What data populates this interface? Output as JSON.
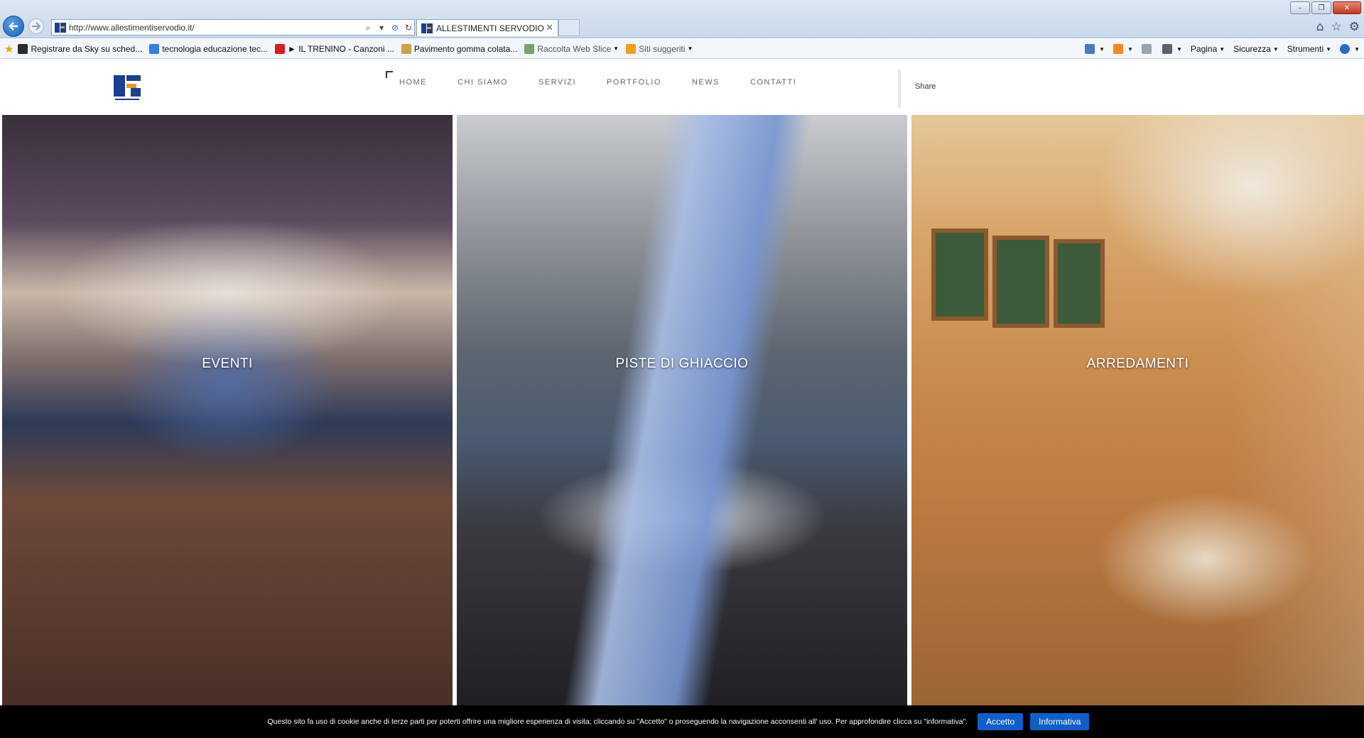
{
  "browser": {
    "url": "http://www.allestimentiservodio.it/",
    "tab_title": "ALLESTIMENTI SERVODIO",
    "window_controls": {
      "minimize": "–",
      "maximize": "❐",
      "close": "✕"
    },
    "right_icons": [
      "home-icon",
      "star-icon",
      "gear-icon"
    ]
  },
  "favorites": {
    "items": [
      {
        "label": "Registrare da Sky su sched...",
        "icon": "sky-icon",
        "color": "#2b2b2b"
      },
      {
        "label": "tecnologia educazione tec...",
        "icon": "google-icon",
        "color": "#3b7be8"
      },
      {
        "label": "► IL TRENINO - Canzoni ...",
        "icon": "youtube-icon",
        "color": "#d91c1c"
      },
      {
        "label": "Pavimento gomma colata...",
        "icon": "page-icon",
        "color": "#c9a24a"
      },
      {
        "label": "Raccolta Web Slice",
        "icon": "webslice-icon",
        "color": "#7aa36e",
        "dropdown": true
      },
      {
        "label": "Siti suggeriti",
        "icon": "suggested-icon",
        "color": "#f0a020",
        "dropdown": true
      }
    ],
    "commands": [
      {
        "label": "",
        "icon": "home-icon",
        "color": "#4a7bc0"
      },
      {
        "label": "",
        "icon": "rss-icon",
        "color": "#f08a24"
      },
      {
        "label": "",
        "icon": "mail-icon",
        "color": "#9aa4b0"
      },
      {
        "label": "",
        "icon": "print-icon",
        "color": "#5a6470"
      },
      {
        "label": "Pagina",
        "icon": "",
        "color": ""
      },
      {
        "label": "Sicurezza",
        "icon": "",
        "color": ""
      },
      {
        "label": "Strumenti",
        "icon": "",
        "color": ""
      },
      {
        "label": "",
        "icon": "help-icon",
        "color": "#2a6ad0"
      }
    ]
  },
  "site": {
    "nav": [
      "HOME",
      "CHI SIAMO",
      "SERVIZI",
      "PORTFOLIO",
      "NEWS",
      "CONTATTI"
    ],
    "share": "Share",
    "panels": [
      {
        "label": "EVENTI"
      },
      {
        "label": "PISTE DI GHIACCIO"
      },
      {
        "label": "ARREDAMENTI"
      }
    ],
    "cookie": {
      "text": "Questo sito fa uso di cookie anche di terze parti per poterti offrire una migliore esperienza di visita; cliccando su \"Accetto\" o proseguendo la navigazione acconsenti all' uso. Per approfondire clicca su \"informativa\".",
      "accept": "Accetto",
      "info": "Informativa"
    }
  }
}
